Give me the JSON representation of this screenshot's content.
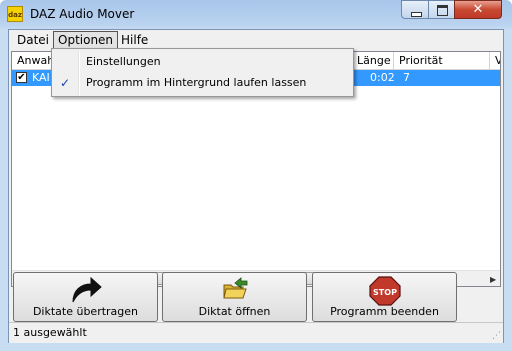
{
  "window": {
    "title": "DAZ Audio Mover",
    "logo_text": "daz",
    "close_glyph": "✕"
  },
  "menu": {
    "datei": "Datei",
    "optionen": "Optionen",
    "hilfe": "Hilfe"
  },
  "dropdown": {
    "items": [
      {
        "label": "Einstellungen",
        "checked": false
      },
      {
        "label": "Programm im Hintergrund laufen lassen",
        "checked": true
      }
    ],
    "check_glyph": "✓"
  },
  "list": {
    "columns": [
      "Anwahl",
      "Länge",
      "Priorität",
      "V"
    ],
    "rows": [
      {
        "selected": true,
        "checked": true,
        "name": "KAI",
        "laenge": "0:02",
        "prioritaet": "7"
      }
    ],
    "check_glyph": "✔",
    "scroll_grip": "|||",
    "scroll_left": "◀",
    "scroll_right": "▶"
  },
  "buttons": {
    "uebertragen": "Diktate übertragen",
    "oeffnen": "Diktat öffnen",
    "beenden": "Programm beenden",
    "stop_text": "STOP"
  },
  "status": {
    "text": "1 ausgewählt",
    "grip": "⋰"
  },
  "colors": {
    "selection": "#3399ff",
    "stop_red": "#c0392b",
    "folder": "#e8c640"
  },
  "icons": [
    "forward-arrow-icon",
    "open-folder-icon",
    "stop-sign-icon"
  ]
}
